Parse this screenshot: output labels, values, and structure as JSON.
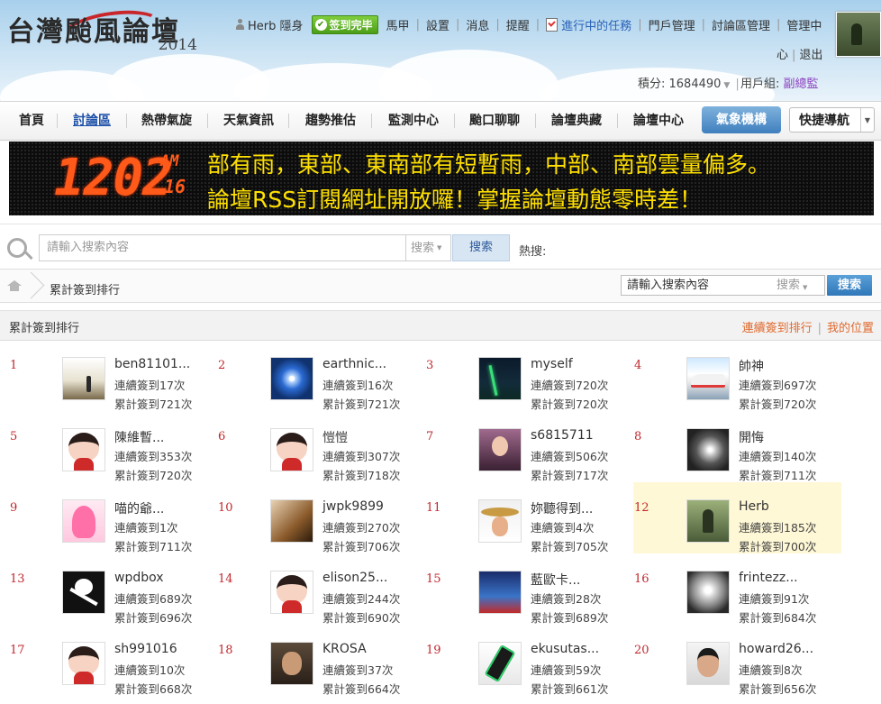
{
  "header": {
    "logo_text": "台灣颱風論壇",
    "logo_year": "2014",
    "user": {
      "name": "Herb",
      "status": "隱身"
    },
    "checkin_label": "签到完毕",
    "menu": [
      "馬甲",
      "設置",
      "消息",
      "提醒"
    ],
    "task_label": "進行中的任務",
    "menu2": [
      "門戶管理",
      "討論區管理",
      "管理中"
    ],
    "menu3": [
      "心",
      "退出"
    ],
    "credits": "積分: 1684490",
    "usergroup_label": "用戶組: ",
    "usergroup_value": "副總監"
  },
  "nav": {
    "items": [
      "首頁",
      "討論區",
      "熱帶氣旋",
      "天氣資訊",
      "趨勢推估",
      "監測中心",
      "颱口聊聊",
      "論壇典藏",
      "論壇中心"
    ],
    "active_index": 1,
    "weather_button": "氣象機構",
    "quick_nav": "快捷導航"
  },
  "banner": {
    "time": "1202",
    "ampm": "AM",
    "seconds": "16",
    "line1": "部有雨，東部、東南部有短暫雨，中部、南部雲量偏多。",
    "line2": "論壇RSS訂閱網址開放囉！掌握論壇動態零時差！"
  },
  "search": {
    "placeholder": "請輸入搜索內容",
    "type": "搜索",
    "button": "搜索",
    "hot_label": "熱搜:"
  },
  "breadcrumb": {
    "current": "累計簽到排行",
    "search_value": "請輸入搜索內容",
    "search_type": "搜索",
    "search_button": "搜索"
  },
  "panel": {
    "title": "累計簽到排行",
    "links": [
      "連續簽到排行",
      "我的位置"
    ]
  },
  "ranking": [
    {
      "rank": "1",
      "name": "ben81101...",
      "streak": "連續簽到17次",
      "total": "累計簽到721次",
      "avatar": "sunset"
    },
    {
      "rank": "2",
      "name": "earthnic...",
      "streak": "連續簽到16次",
      "total": "累計簽到721次",
      "avatar": "typhoon"
    },
    {
      "rank": "3",
      "name": "myself",
      "streak": "連續簽到720次",
      "total": "累計簽到720次",
      "avatar": "bridge"
    },
    {
      "rank": "4",
      "name": "帥神",
      "streak": "連續簽到697次",
      "total": "累計簽到720次",
      "avatar": "train"
    },
    {
      "rank": "5",
      "name": "陳維暫...",
      "streak": "連續簽到353次",
      "total": "累計簽到720次",
      "avatar": "default"
    },
    {
      "rank": "6",
      "name": "愷愷",
      "streak": "連續簽到307次",
      "total": "累計簽到718次",
      "avatar": "default"
    },
    {
      "rank": "7",
      "name": "s6815711",
      "streak": "連續簽到506次",
      "total": "累計簽到717次",
      "avatar": "girl"
    },
    {
      "rank": "8",
      "name": "開悔",
      "streak": "連續簽到140次",
      "total": "累計簽到711次",
      "avatar": "storm"
    },
    {
      "rank": "9",
      "name": "喵的爺...",
      "streak": "連續簽到1次",
      "total": "累計簽到711次",
      "avatar": "anime"
    },
    {
      "rank": "10",
      "name": "jwpk9899",
      "streak": "連續簽到270次",
      "total": "累計簽到706次",
      "avatar": "warrior"
    },
    {
      "rank": "11",
      "name": "妳聽得到...",
      "streak": "連續簽到4次",
      "total": "累計簽到705次",
      "avatar": "hat"
    },
    {
      "rank": "12",
      "name": "Herb",
      "streak": "連續簽到185次",
      "total": "累計簽到700次",
      "avatar": "herb",
      "highlight": true
    },
    {
      "rank": "13",
      "name": "wpdbox",
      "streak": "連續簽到689次",
      "total": "累計簽到696次",
      "avatar": "pirate"
    },
    {
      "rank": "14",
      "name": "elison25...",
      "streak": "連續簽到244次",
      "total": "累計簽到690次",
      "avatar": "default"
    },
    {
      "rank": "15",
      "name": "藍歐卡...",
      "streak": "連續簽到28次",
      "total": "累計簽到689次",
      "avatar": "ufo"
    },
    {
      "rank": "16",
      "name": "frintezz...",
      "streak": "連續簽到91次",
      "total": "累計簽到684次",
      "avatar": "spiral"
    },
    {
      "rank": "17",
      "name": "sh991016",
      "streak": "連續簽到10次",
      "total": "累計簽到668次",
      "avatar": "default"
    },
    {
      "rank": "18",
      "name": "KROSA",
      "streak": "連續簽到37次",
      "total": "累計簽到664次",
      "avatar": "face"
    },
    {
      "rank": "19",
      "name": "ekusutas...",
      "streak": "連續簽到59次",
      "total": "累計簽到661次",
      "avatar": "phone"
    },
    {
      "rank": "20",
      "name": "howard26...",
      "streak": "連續簽到8次",
      "total": "累計簽到656次",
      "avatar": "portrait"
    }
  ],
  "colors": {
    "rank_number": "#c1272d",
    "highlight_bg": "#fff8d6",
    "panel_link": "#e06a2e",
    "led_digits": "#ff5a1a",
    "led_text": "#ffe000",
    "nav_active": "#1b4fa8"
  }
}
